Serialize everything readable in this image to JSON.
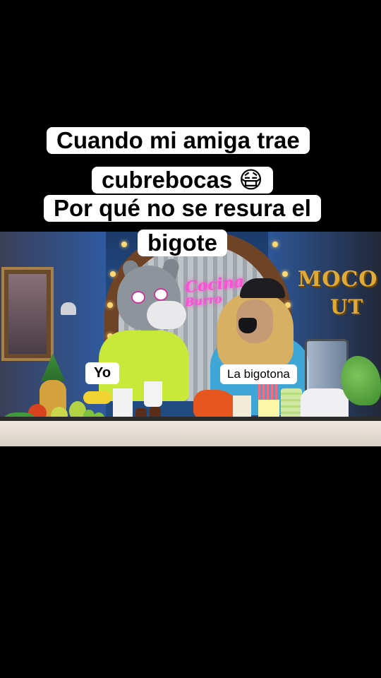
{
  "caption": {
    "line1": "Cuando mi amiga trae",
    "line2": "cubrebocas 😷",
    "line3": "Por qué no se resura el",
    "line4": "bigote"
  },
  "labels": {
    "left": "Yo",
    "right": "La bigotona"
  },
  "scene": {
    "neon_sign": [
      "Cocina",
      "Burro"
    ],
    "wall_sign": [
      "MOCO",
      "UT"
    ]
  }
}
